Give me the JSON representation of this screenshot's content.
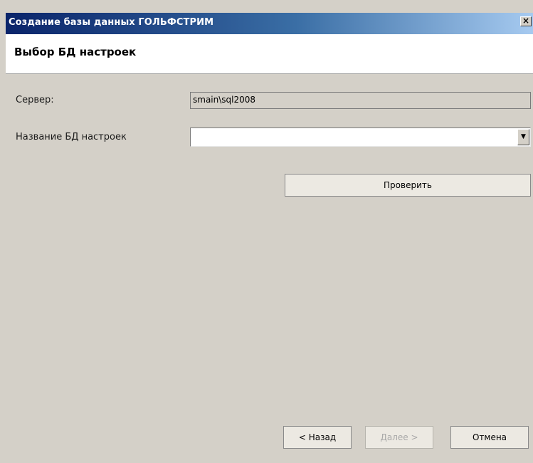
{
  "window": {
    "title": "Создание базы данных ГОЛЬФСТРИМ",
    "close_glyph": "×"
  },
  "header": {
    "title": "Выбор БД настроек"
  },
  "form": {
    "server_label": "Сервер:",
    "server_value": "smain\\sql2008",
    "db_name_label": "Название БД настроек",
    "db_name_value": "",
    "dropdown_glyph": "▼"
  },
  "buttons": {
    "check": "Проверить",
    "back": "< Назад",
    "next": "Далее >",
    "cancel": "Отмена"
  },
  "colors": {
    "dialog_bg": "#d4d0c8",
    "titlebar_start": "#0a246a",
    "titlebar_end": "#a6caf0",
    "disabled_text": "#a8a8a8"
  },
  "icons": {
    "close": "close-icon",
    "dropdown": "chevron-down-icon"
  }
}
